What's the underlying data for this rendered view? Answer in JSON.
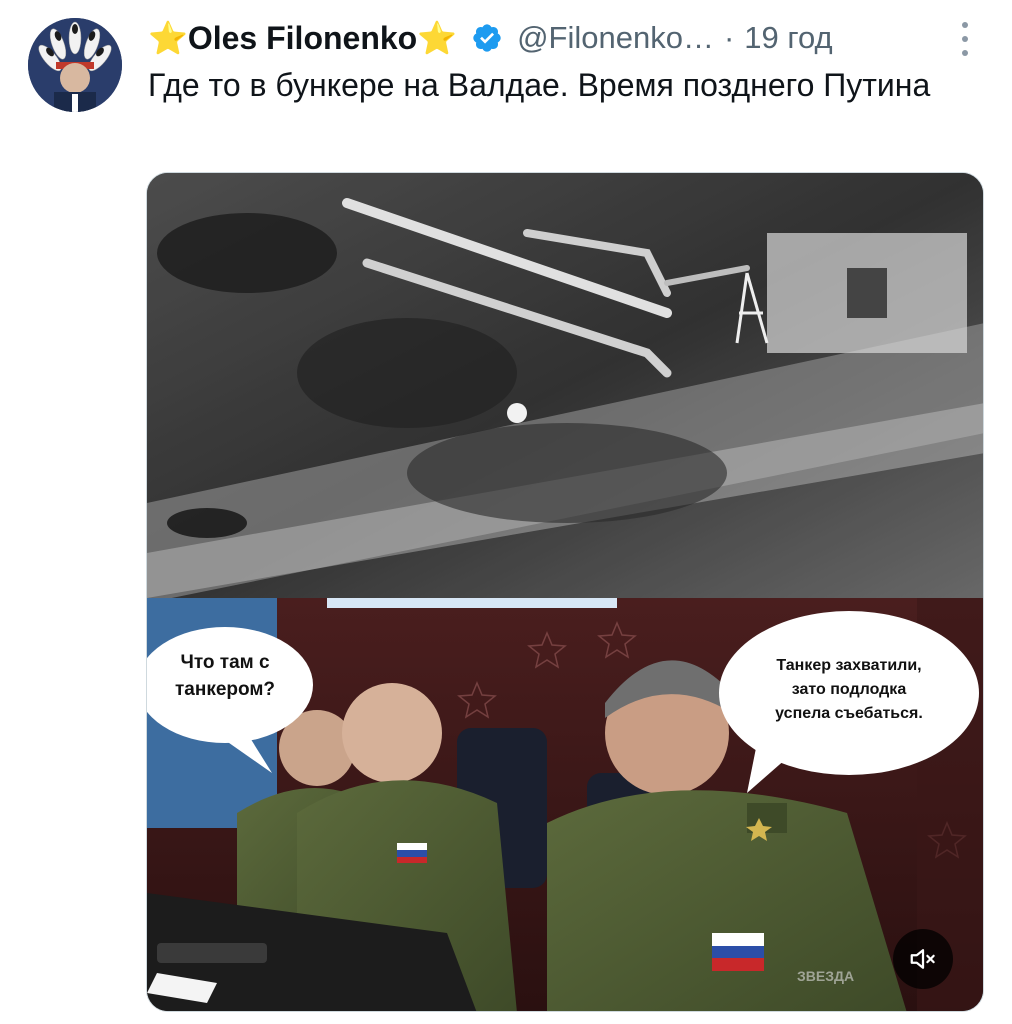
{
  "author": {
    "display_name": "Oles Filonenko",
    "prefix_emoji": "⭐",
    "suffix_emoji": "⭐",
    "handle": "@Filonenko…",
    "separator": "·",
    "time": "19 год",
    "verified": true
  },
  "tweet": {
    "text": "Где то в бункере на Валдае. Время позднего Путина"
  },
  "media": {
    "bubble_left": {
      "line1": "Что там с",
      "line2": "танкером?"
    },
    "bubble_right": {
      "line1": "Танкер захватили,",
      "line2": "зато подлодка",
      "line3": "успела съебаться."
    },
    "watermark": "ЗВЕЗДА",
    "mute_icon": "speaker-muted-icon"
  },
  "colors": {
    "text_primary": "#0f1419",
    "text_secondary": "#536471",
    "verified": "#1d9bf0",
    "star": "#f5b400"
  }
}
